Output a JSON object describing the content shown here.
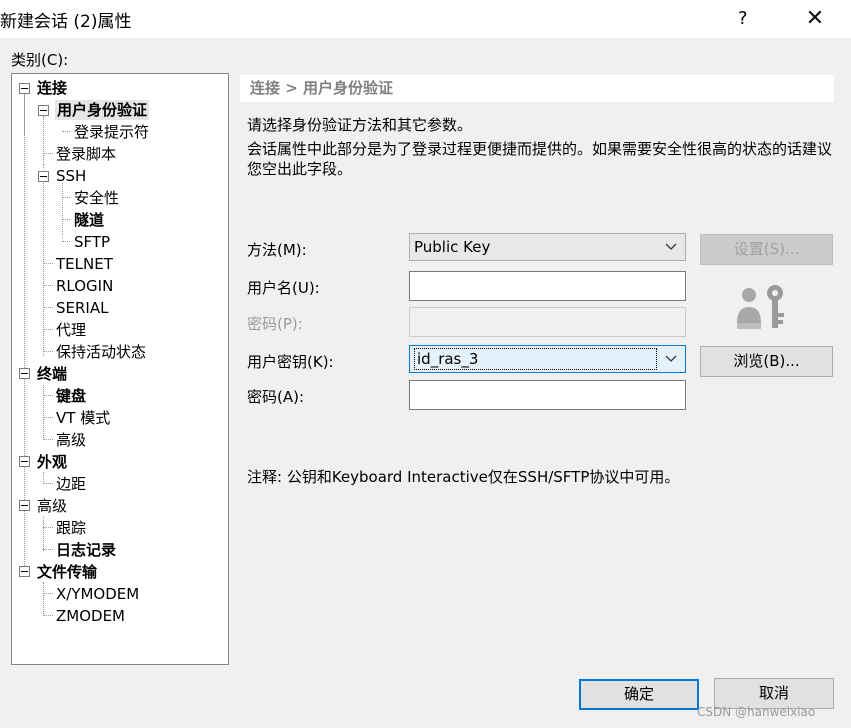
{
  "window": {
    "title": "新建会话 (2)属性",
    "help_glyph": "?",
    "close_glyph": "✕"
  },
  "category_label": "类别(C):",
  "tree": [
    {
      "label": "连接",
      "bold": true
    },
    {
      "label": "用户身份验证",
      "bold": true,
      "selected": true
    },
    {
      "label": "登录提示符",
      "bold": false
    },
    {
      "label": "登录脚本",
      "bold": false
    },
    {
      "label": "SSH",
      "bold": false
    },
    {
      "label": "安全性",
      "bold": false
    },
    {
      "label": "隧道",
      "bold": true
    },
    {
      "label": "SFTP",
      "bold": false
    },
    {
      "label": "TELNET",
      "bold": false
    },
    {
      "label": "RLOGIN",
      "bold": false
    },
    {
      "label": "SERIAL",
      "bold": false
    },
    {
      "label": "代理",
      "bold": false
    },
    {
      "label": "保持活动状态",
      "bold": false
    },
    {
      "label": "终端",
      "bold": true
    },
    {
      "label": "键盘",
      "bold": true
    },
    {
      "label": "VT 模式",
      "bold": false
    },
    {
      "label": "高级",
      "bold": false
    },
    {
      "label": "外观",
      "bold": true
    },
    {
      "label": "边距",
      "bold": false
    },
    {
      "label": "高级",
      "bold": false
    },
    {
      "label": "跟踪",
      "bold": false
    },
    {
      "label": "日志记录",
      "bold": true
    },
    {
      "label": "文件传输",
      "bold": true
    },
    {
      "label": "X/YMODEM",
      "bold": false
    },
    {
      "label": "ZMODEM",
      "bold": false
    }
  ],
  "panel": {
    "header": "连接 > 用户身份验证",
    "description1": "请选择身份验证方法和其它参数。",
    "description2": "会话属性中此部分是为了登录过程更便捷而提供的。如果需要安全性很高的状态的话建议您空出此字段。",
    "method_label": "方法(M):",
    "method_value": "Public Key",
    "settings_button": "设置(S)...",
    "username_label": "用户名(U):",
    "username_value": "",
    "password_label": "密码(P):",
    "userkey_label": "用户密钥(K):",
    "userkey_value": "id_ras_3",
    "browse_button": "浏览(B)...",
    "passphrase_label": "密码(A):",
    "passphrase_value": "",
    "note": "注释: 公钥和Keyboard Interactive仅在SSH/SFTP协议中可用。",
    "dropdown_icon": "chevron-down-icon",
    "key_icon": "user-key-icon"
  },
  "footer": {
    "ok_button": "确定",
    "cancel_button": "取消",
    "watermark": "CSDN @hanweixiao"
  }
}
